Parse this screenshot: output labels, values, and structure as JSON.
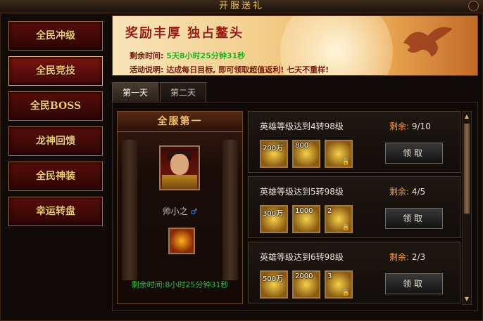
{
  "window": {
    "title": "开服送礼"
  },
  "sidebar": {
    "items": [
      {
        "label": "全民冲级"
      },
      {
        "label": "全民竞技"
      },
      {
        "label": "全民BOSS"
      },
      {
        "label": "龙神回馈"
      },
      {
        "label": "全民神装"
      },
      {
        "label": "幸运转盘"
      }
    ]
  },
  "banner": {
    "title": "奖励丰厚  独占鳌头",
    "remain_label": "剩余时间:",
    "remain_value": "5天8小时25分钟31秒",
    "desc_label": "活动说明:",
    "desc_value": "达成每日目标, 即可领取超值返利! 七天不重样!"
  },
  "tabs": [
    {
      "label": "第一天",
      "active": true
    },
    {
      "label": "第二天",
      "active": false
    }
  ],
  "rank": {
    "heading": "全服第一",
    "player_name": "帅小之",
    "remain_text": "剩余时间:8小时25分钟31秒"
  },
  "tasks": [
    {
      "title": "英雄等级达到4转98级",
      "remain_label": "剩余:",
      "remain_value": "9/10",
      "items": [
        {
          "count": "200万"
        },
        {
          "count": "800"
        },
        {
          "count": ""
        }
      ],
      "claim": "领取"
    },
    {
      "title": "英雄等级达到5转98级",
      "remain_label": "剩余:",
      "remain_value": "4/5",
      "items": [
        {
          "count": "300万"
        },
        {
          "count": "1000"
        },
        {
          "count": "2"
        }
      ],
      "claim": "领取"
    },
    {
      "title": "英雄等级达到6转98级",
      "remain_label": "剩余:",
      "remain_value": "2/3",
      "items": [
        {
          "count": "500万"
        },
        {
          "count": "2000"
        },
        {
          "count": "3"
        }
      ],
      "claim": "领取"
    }
  ]
}
